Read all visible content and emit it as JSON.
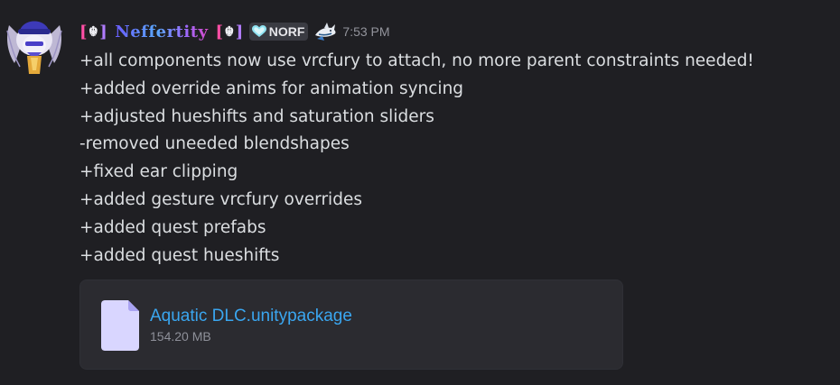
{
  "message": {
    "author": {
      "bracket_left": "[",
      "khanda": "☬",
      "bracket_right": "]",
      "name": "Neffertity",
      "suffix_bracket_left": "[",
      "suffix_khanda": "☬",
      "suffix_bracket_right": "]"
    },
    "role_tag": {
      "icon": "heart-icon",
      "label": "NORF"
    },
    "badge_icon": "shark-icon",
    "timestamp": "7:53 PM",
    "lines": [
      "+all components now use vrcfury to attach, no more parent constraints needed!",
      "+added override anims for animation syncing",
      "+adjusted hueshifts and saturation sliders",
      "-removed uneeded blendshapes",
      "+fixed ear clipping",
      "+added gesture vrcfury overrides",
      "+added quest prefabs",
      "+added quest hueshifts"
    ],
    "attachment": {
      "icon": "file-icon",
      "file_name": "Aquatic DLC.unitypackage",
      "file_size": "154.20 MB"
    }
  },
  "colors": {
    "background": "#1f1f23",
    "text": "#dbdee1",
    "link": "#3aa6f0",
    "muted": "#93949c",
    "attachment_bg": "#2b2b30"
  }
}
